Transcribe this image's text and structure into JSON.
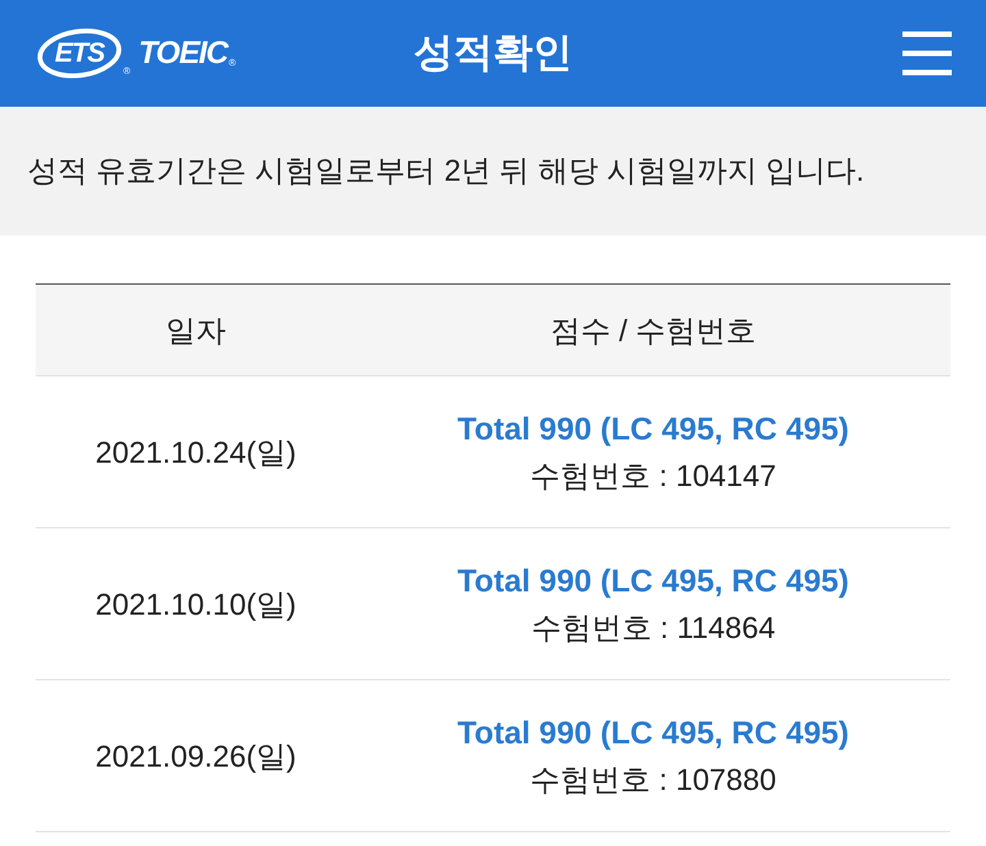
{
  "header": {
    "logo": {
      "mark": "ETS",
      "mark_sign": "®",
      "name": "TOEIC",
      "name_sign": "®"
    },
    "title": "성적확인"
  },
  "notice": "성적 유효기간은 시험일로부터 2년 뒤 해당 시험일까지 입니다.",
  "table": {
    "columns": [
      "일자",
      "점수 / 수험번호"
    ],
    "rows": [
      {
        "date": "2021.10.24(일)",
        "score": "Total 990 (LC 495, RC 495)",
        "exam_number": "수험번호 : 104147"
      },
      {
        "date": "2021.10.10(일)",
        "score": "Total 990 (LC 495, RC 495)",
        "exam_number": "수험번호 : 114864"
      },
      {
        "date": "2021.09.26(일)",
        "score": "Total 990 (LC 495, RC 495)",
        "exam_number": "수험번호 : 107880"
      }
    ]
  }
}
